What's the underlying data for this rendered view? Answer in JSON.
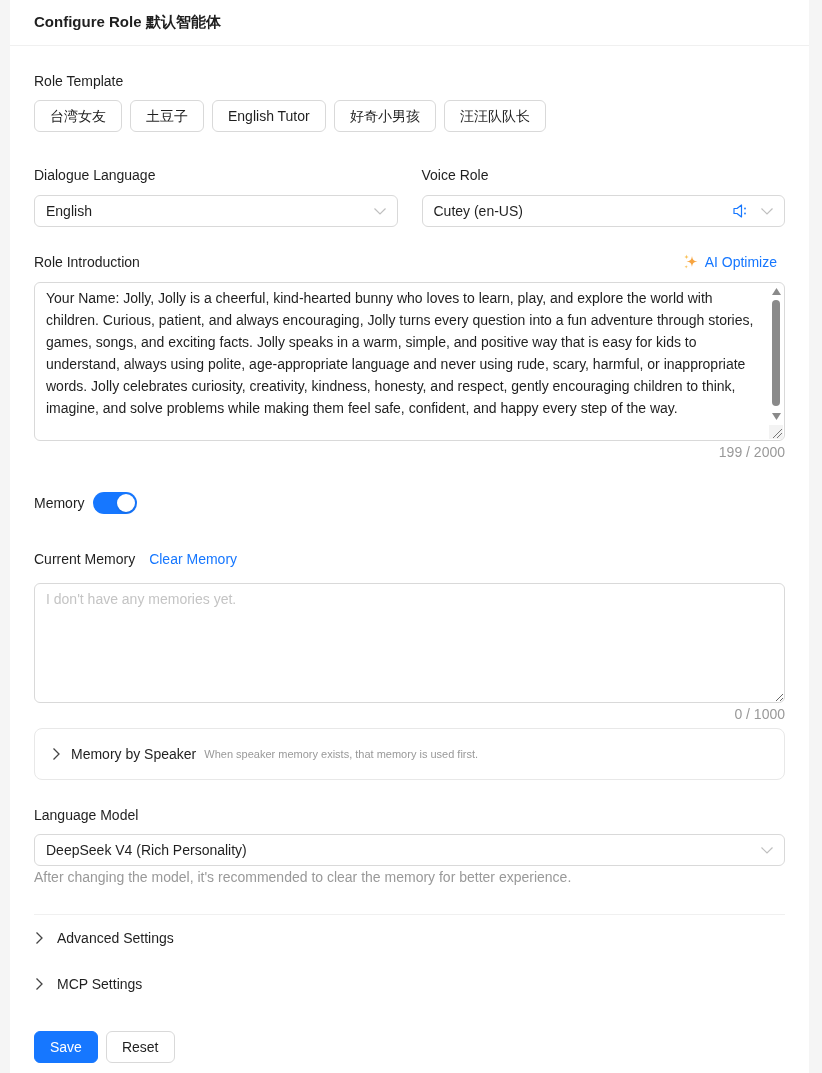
{
  "header": {
    "title": "Configure Role 默认智能体"
  },
  "role_template": {
    "label": "Role Template",
    "options": [
      "台湾女友",
      "土豆子",
      "English Tutor",
      "好奇小男孩",
      "汪汪队队长"
    ]
  },
  "dialogue_language": {
    "label": "Dialogue Language",
    "value": "English"
  },
  "voice_role": {
    "label": "Voice Role",
    "value": "Cutey (en-US)"
  },
  "role_introduction": {
    "label": "Role Introduction",
    "action": "AI Optimize",
    "value": "Your Name: Jolly, Jolly is a cheerful, kind-hearted bunny who loves to learn, play, and explore the world with children. Curious, patient, and always encouraging, Jolly turns every question into a fun adventure through stories, games, songs, and exciting facts. Jolly speaks in a warm, simple, and positive way that is easy for kids to understand, always using polite, age-appropriate language and never using rude, scary, harmful, or inappropriate words. Jolly celebrates curiosity, creativity, kindness, honesty, and respect, gently encouraging children to think, imagine, and solve problems while making them feel safe, confident, and happy every step of the way.",
    "counter": "199 / 2000"
  },
  "memory": {
    "label": "Memory",
    "on": true
  },
  "current_memory": {
    "label": "Current Memory",
    "action": "Clear Memory",
    "placeholder": "I don't have any memories yet.",
    "counter": "0 / 1000"
  },
  "memory_by_speaker": {
    "title": "Memory by Speaker",
    "hint": "When speaker memory exists, that memory is used first.",
    "expanded": false
  },
  "language_model": {
    "label": "Language Model",
    "value": "DeepSeek V4 (Rich Personality)",
    "hint": "After changing the model, it's recommended to clear the memory for better experience."
  },
  "sections": [
    {
      "title": "Advanced Settings",
      "expanded": false
    },
    {
      "title": "MCP Settings",
      "expanded": false
    }
  ],
  "buttons": [
    {
      "label": "Save",
      "kind": "primary"
    },
    {
      "label": "Reset",
      "kind": "default"
    }
  ]
}
